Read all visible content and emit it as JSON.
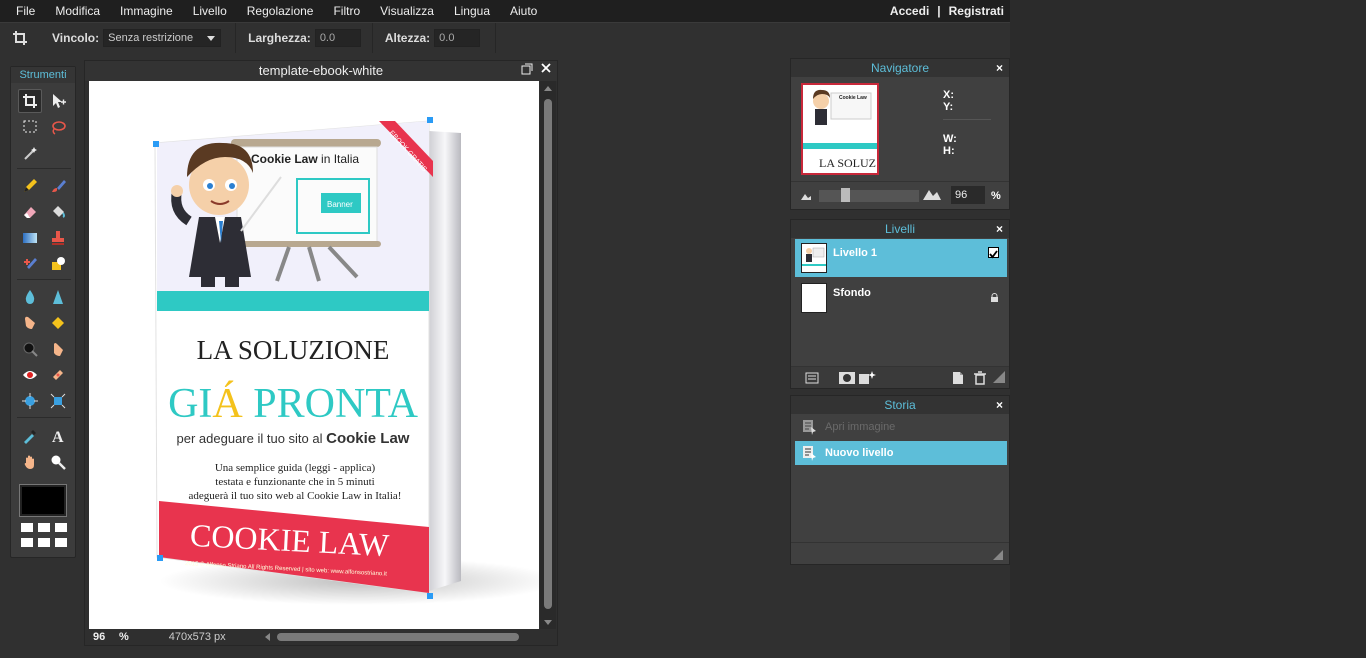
{
  "menu": {
    "items": [
      "File",
      "Modifica",
      "Immagine",
      "Livello",
      "Regolazione",
      "Filtro",
      "Visualizza",
      "Lingua",
      "Aiuto"
    ],
    "login": "Accedi",
    "separator": "|",
    "register": "Registrati"
  },
  "options": {
    "constraint_label": "Vincolo:",
    "constraint_value": "Senza restrizione",
    "width_label": "Larghezza:",
    "width_value": "0.0",
    "height_label": "Altezza:",
    "height_value": "0.0"
  },
  "tools": {
    "title": "Strumenti",
    "foreground_color": "#000000"
  },
  "document": {
    "title": "template-ebook-white",
    "zoom": "96",
    "zoom_unit": "%",
    "dimensions": "470x573 px"
  },
  "ebook": {
    "badge": "EBOOK GRATIS",
    "board_title_bold": "Cookie Law",
    "board_title_rest": " in Italia",
    "board_button": "Banner",
    "headline": "LA SOLUZIONE",
    "big_1": "GI",
    "big_accent": "Á",
    "big_2": " PRONTA",
    "subline_light": "per adeguare il tuo sito al ",
    "subline_bold": "Cookie Law",
    "desc_1": "Una semplice guida (leggi - applica)",
    "desc_2": "testata e funzionante che in 5 minuti",
    "desc_3": "adeguerà il tuo sito web al Cookie Law in Italia!",
    "banner_title": "COOKIE LAW",
    "footer": "2015 © Alfonso Striano All Rights Reserved | sito web: www.alfonsostriano.it"
  },
  "navigator": {
    "title": "Navigatore",
    "close": "×",
    "x_label": "X:",
    "y_label": "Y:",
    "w_label": "W:",
    "h_label": "H:",
    "zoom": "96",
    "zoom_unit": "%",
    "thumb_text": "LA SOLUZ"
  },
  "layers": {
    "title": "Livelli",
    "close": "×",
    "items": [
      {
        "name": "Livello 1"
      },
      {
        "name": "Sfondo"
      }
    ]
  },
  "history": {
    "title": "Storia",
    "close": "×",
    "items": [
      {
        "label": "Apri immagine"
      },
      {
        "label": "Nuovo livello"
      }
    ]
  },
  "colors": {
    "accent": "#5dbed9",
    "teal": "#2ec9c4",
    "red": "#e8344e",
    "yellow": "#f4c21c"
  }
}
